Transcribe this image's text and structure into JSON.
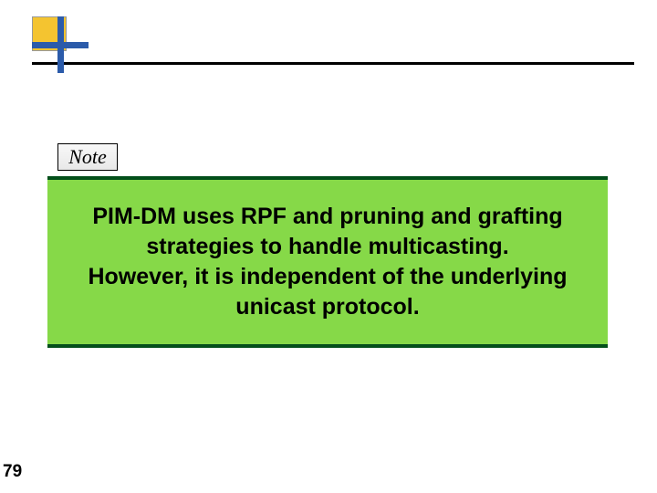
{
  "note_label": "Note",
  "body_text": "PIM-DM uses RPF and pruning and grafting strategies to handle multicasting.\nHowever, it is independent of the underlying unicast protocol.",
  "page_number": "79"
}
